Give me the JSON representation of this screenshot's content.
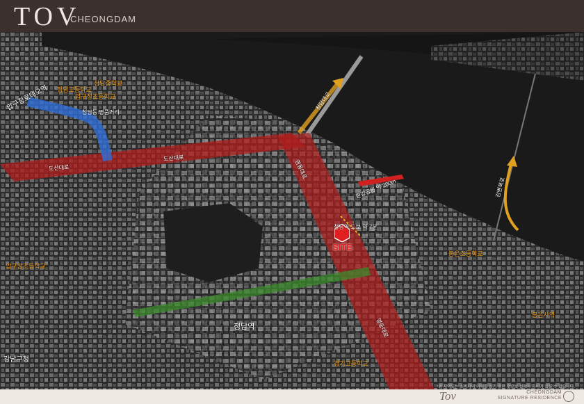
{
  "header": {
    "logo": "TOV",
    "subtitle": "CHEONGDAM"
  },
  "map": {
    "site_label": "SITE",
    "station_label": "청담역",
    "roads": {
      "dosan_left": "도산대로",
      "dosan_right": "도산대로",
      "apgujeong": "압구정로데오역",
      "cheongdam_bridge": "청담대교",
      "yeongdong_upper": "영동대로",
      "yeongdong_lower": "영동대로",
      "riverside": "강변북로",
      "site_walk": "청담역 도보 약 7분",
      "apgu_line": "청담동 명품거리",
      "han_river_view": "한강공원 약 200m"
    },
    "poi": {
      "school1": "청담고등학교",
      "school2": "청담중학교",
      "school3": "압구정초등학교",
      "school4": "봉은초등학교",
      "school5": "경기고등학교",
      "school6": "봉은사역",
      "office": "강남구청"
    }
  },
  "footer": {
    "signature": "Tov",
    "brand_line1": "CHEONGDAM",
    "brand_line2": "SIGNATURE RESIDENCE",
    "disclaimer": "*위 지역도는 소비자의 이해를 돕기 위한 것으로 실제와 차이가 있을 수 있습니다."
  },
  "colors": {
    "header_bg": "#3b302d",
    "road_red": "#b01c1c",
    "road_blue": "#2f6fd8",
    "road_green": "#3a8a2a",
    "arrow_orange": "#e0a020"
  }
}
